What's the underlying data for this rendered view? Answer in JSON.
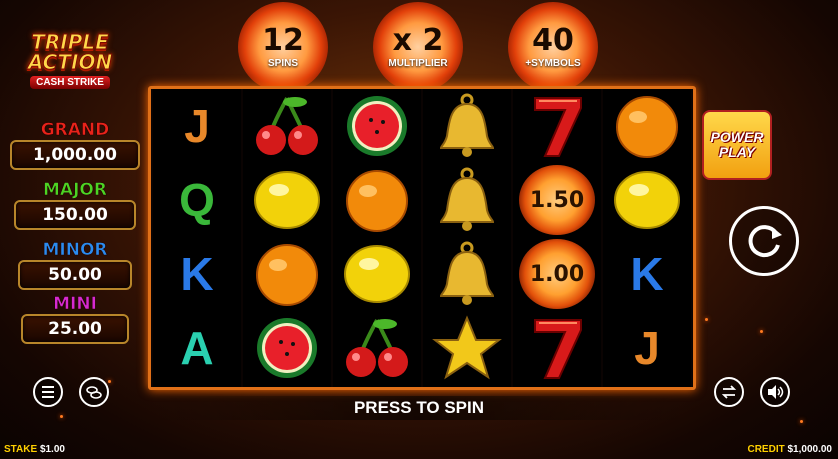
{
  "logo": {
    "line1": "TRIPLE",
    "line2": "ACTION",
    "line3": "CASH STRIKE"
  },
  "jackpots": [
    {
      "name": "GRAND",
      "value": "1,000.00",
      "color": "#e8231a"
    },
    {
      "name": "MAJOR",
      "value": "150.00",
      "color": "#4cd424"
    },
    {
      "name": "MINOR",
      "value": "50.00",
      "color": "#2a8cf0"
    },
    {
      "name": "MINI",
      "value": "25.00",
      "color": "#d62ad0"
    }
  ],
  "features": [
    {
      "value": "12",
      "label": "SPINS"
    },
    {
      "value": "x 2",
      "label": "MULTIPLIER"
    },
    {
      "value": "40",
      "label": "+SYMBOLS"
    }
  ],
  "reels": [
    [
      "J",
      "Q",
      "K",
      "A"
    ],
    [
      "cherry",
      "lemon",
      "orange",
      "watermelon"
    ],
    [
      "watermelon",
      "orange",
      "lemon",
      "cherry"
    ],
    [
      "bell",
      "bell",
      "bell",
      "star"
    ],
    [
      "seven",
      "1.50",
      "1.00",
      "seven"
    ],
    [
      "orange",
      "lemon",
      "K",
      "J"
    ]
  ],
  "letter_colors": {
    "J": "#e8882a",
    "Q": "#3ab83a",
    "K": "#2a7ae8",
    "A": "#2ad0b0"
  },
  "power_play": {
    "line1": "POWER",
    "line2": "PLAY"
  },
  "press_to_spin": "PRESS TO SPIN",
  "stake": {
    "label": "STAKE",
    "value": "$1.00"
  },
  "credit": {
    "label": "CREDIT",
    "value": "$1,000.00"
  },
  "icons": [
    "menu-icon",
    "coins-icon",
    "spin-icon",
    "autoplay-icon",
    "sound-icon"
  ]
}
